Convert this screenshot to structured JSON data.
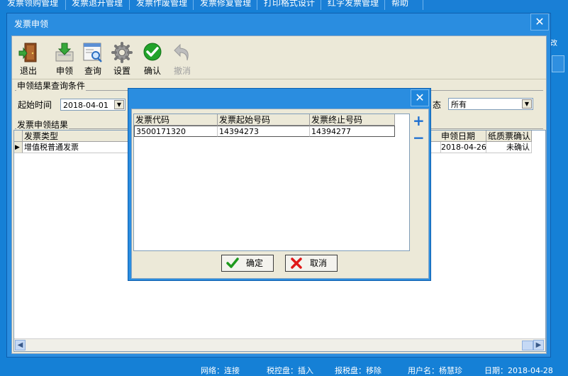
{
  "menu": [
    "发票领购管理",
    "发票退开管理",
    "发票作废管理",
    "发票修复管理",
    "打印格式设计",
    "红字发票管理",
    "帮助"
  ],
  "main_window": {
    "title": "发票申领",
    "close_glyph": "✕",
    "toolbar": [
      {
        "label": "退出",
        "icon": "exit-door-icon"
      },
      {
        "label": "申领",
        "icon": "apply-download-icon"
      },
      {
        "label": "查询",
        "icon": "query-magnifier-icon"
      },
      {
        "label": "设置",
        "icon": "settings-gear-icon"
      },
      {
        "label": "确认",
        "icon": "confirm-check-icon"
      },
      {
        "label": "撤消",
        "icon": "undo-arrow-icon"
      }
    ],
    "query_group": {
      "title": "申领结果查询条件",
      "start_time_label": "起始时间",
      "start_time_value": "2018-04-01",
      "status_label_partial": "态",
      "status_value": "所有"
    },
    "result_group": {
      "title": "发票申领结果",
      "columns": [
        "发票类型",
        "申领日期",
        "纸质票确认"
      ],
      "rows": [
        {
          "type": "增值税普通发票",
          "date": "2018-04-26",
          "confirm": "未确认"
        }
      ]
    }
  },
  "dialog": {
    "close_glyph": "✕",
    "columns": [
      "发票代码",
      "发票起始号码",
      "发票终止号码"
    ],
    "rows": [
      {
        "code": "3500171320",
        "start": "14394273",
        "end": "14394277"
      }
    ],
    "add_glyph": "+",
    "remove_glyph": "−",
    "ok_label": "确定",
    "cancel_label": "取消"
  },
  "status_bar": {
    "network": "网络：连接",
    "tax_disk": "税控盘：插入",
    "report_disk": "报税盘：移除",
    "user": "用户名：杨慧珍",
    "date": "日期：2018-04-28"
  },
  "colors": {
    "title_bar": "#2a8de0",
    "panel": "#ece9d8",
    "accent_blue": "#1580d6"
  }
}
